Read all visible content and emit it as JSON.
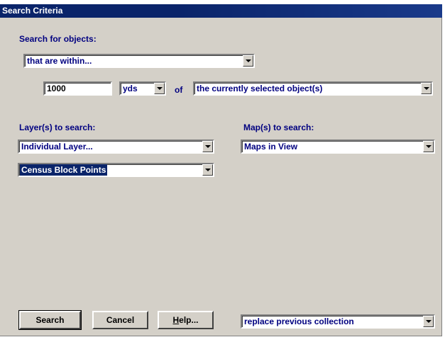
{
  "window": {
    "title": "Search Criteria"
  },
  "search_for": {
    "label": "Search for objects:",
    "mode": "that are within...",
    "distance": "1000",
    "unit": "yds",
    "of_label": "of",
    "reference": "the currently selected object(s)"
  },
  "layers": {
    "label": "Layer(s) to search:",
    "type": "Individual Layer...",
    "selected_layer": "Census Block Points"
  },
  "maps": {
    "label": "Map(s) to search:",
    "value": "Maps in View"
  },
  "buttons": {
    "search": "Search",
    "cancel": "Cancel",
    "help_prefix": "H",
    "help_rest": "elp..."
  },
  "collection_mode": "replace previous collection"
}
